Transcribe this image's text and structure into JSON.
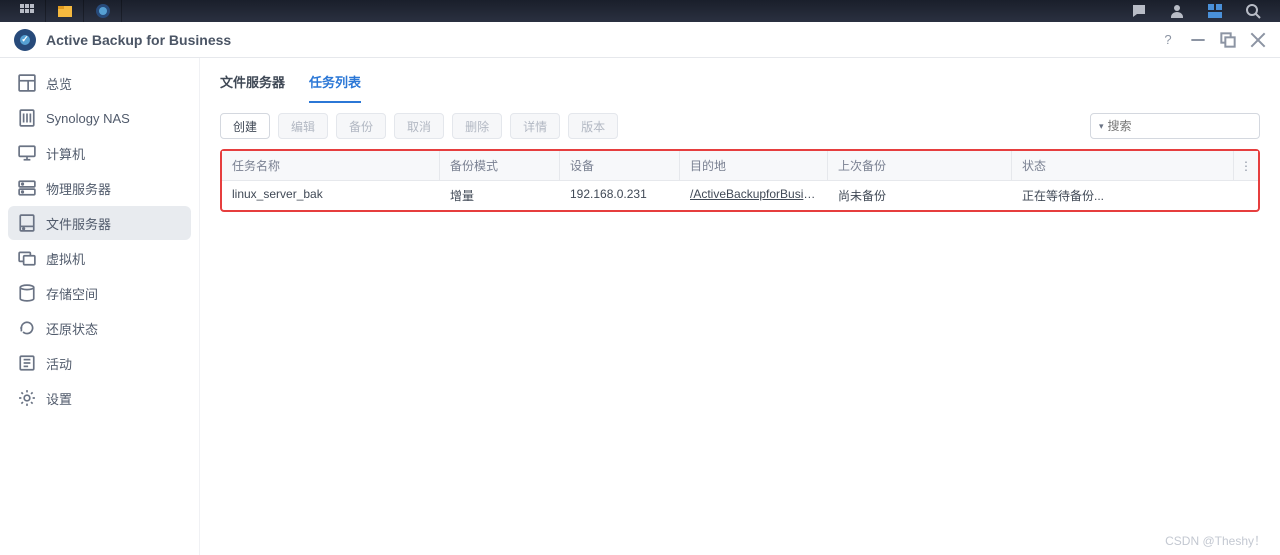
{
  "taskbar": {
    "icons_left": [
      "apps-grid-icon",
      "folder-app-icon",
      "backup-app-icon"
    ],
    "icons_right": [
      "chat-icon",
      "user-icon",
      "widget-icon",
      "search-icon"
    ]
  },
  "window": {
    "title": "Active Backup for Business",
    "controls": [
      "help-icon",
      "minimize-icon",
      "maximize-icon",
      "close-icon"
    ]
  },
  "sidebar": {
    "items": [
      {
        "label": "总览",
        "icon": "dashboard-icon"
      },
      {
        "label": "Synology NAS",
        "icon": "nas-icon"
      },
      {
        "label": "计算机",
        "icon": "monitor-icon"
      },
      {
        "label": "物理服务器",
        "icon": "server-icon"
      },
      {
        "label": "文件服务器",
        "icon": "file-server-icon",
        "active": true
      },
      {
        "label": "虚拟机",
        "icon": "vm-icon"
      },
      {
        "label": "存储空间",
        "icon": "storage-icon"
      },
      {
        "label": "还原状态",
        "icon": "restore-icon"
      },
      {
        "label": "活动",
        "icon": "activity-icon"
      },
      {
        "label": "设置",
        "icon": "gear-icon"
      }
    ]
  },
  "tabs": [
    {
      "label": "文件服务器",
      "active": false
    },
    {
      "label": "任务列表",
      "active": true
    }
  ],
  "toolbar": {
    "buttons": [
      {
        "label": "创建",
        "disabled": false
      },
      {
        "label": "编辑",
        "disabled": true
      },
      {
        "label": "备份",
        "disabled": true
      },
      {
        "label": "取消",
        "disabled": true
      },
      {
        "label": "删除",
        "disabled": true
      },
      {
        "label": "详情",
        "disabled": true
      },
      {
        "label": "版本",
        "disabled": true
      }
    ],
    "search_placeholder": "搜索"
  },
  "table": {
    "headers": {
      "name": "任务名称",
      "mode": "备份模式",
      "device": "设备",
      "destination": "目的地",
      "last": "上次备份",
      "status": "状态"
    },
    "rows": [
      {
        "name": "linux_server_bak",
        "mode": "增量",
        "device": "192.168.0.231",
        "destination": "/ActiveBackupforBusin...",
        "last": "尚未备份",
        "status": "正在等待备份..."
      }
    ]
  },
  "watermark": "CSDN @Theshy！"
}
